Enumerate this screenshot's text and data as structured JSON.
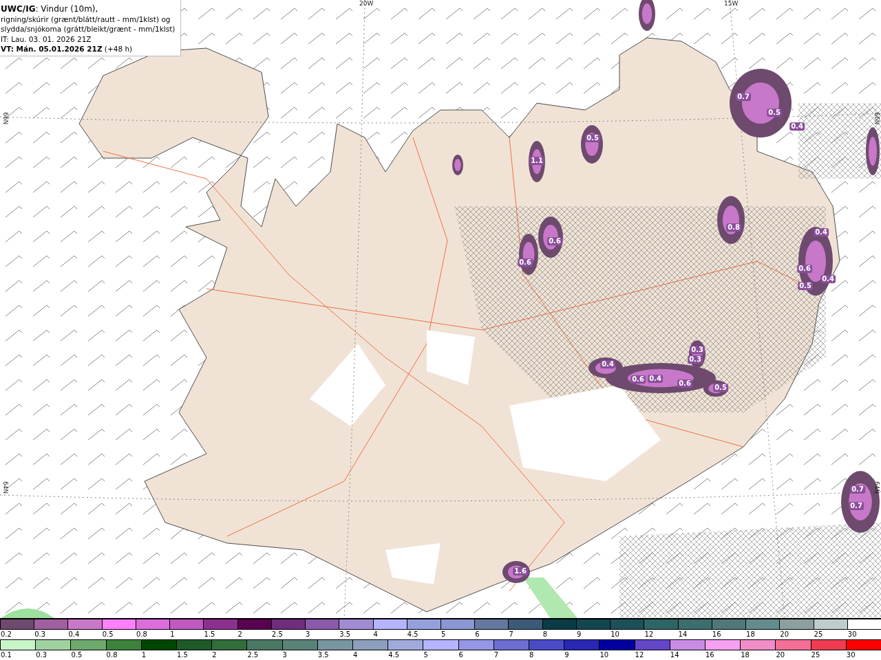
{
  "info_box": {
    "lines": [
      "**UWC/IG**: Vindur (10m),",
      "rigning/skúrir (grænt/blátt/rautt - mm/1klst) og",
      "slydda/snjókoma (grátt/bleikt/grænt - mm/1klst)",
      "IT: Lau. 03. 01. 2026 21Z",
      "**VT: Mán. 05.01.2026 21Z** (+48 h)"
    ]
  },
  "axis_labels": {
    "top": [
      "20W",
      "15W"
    ],
    "left": [
      "66N",
      "64N"
    ],
    "right": [
      "66N",
      "64N"
    ]
  },
  "map_labels": [
    "0.7",
    "0.5",
    "0.4",
    "0.5",
    "1.1",
    "0.8",
    "0.6",
    "0.6",
    "0.4",
    "0.6",
    "0.5",
    "0.4",
    "0.3",
    "0.3",
    "0.4",
    "0.6",
    "0.4",
    "0.6",
    "0.5",
    "0.7",
    "0.7",
    "1.6"
  ],
  "legends": [
    {
      "items": [
        {
          "label": "0.2",
          "color": "#6e4a6e"
        },
        {
          "label": "0.3",
          "color": "#a0609f"
        },
        {
          "label": "0.4",
          "color": "#c878c8"
        },
        {
          "label": "0.5",
          "color": "#ff80ff"
        },
        {
          "label": "0.8",
          "color": "#dc6edc"
        },
        {
          "label": "1",
          "color": "#c05ac0"
        },
        {
          "label": "1.5",
          "color": "#8c3090"
        },
        {
          "label": "2",
          "color": "#5a0050"
        },
        {
          "label": "2.5",
          "color": "#6e2d7d"
        },
        {
          "label": "3",
          "color": "#8c5aaa"
        },
        {
          "label": "3.5",
          "color": "#a08cd2"
        },
        {
          "label": "4",
          "color": "#b4b4ff"
        },
        {
          "label": "4.5",
          "color": "#96a0dc"
        },
        {
          "label": "5",
          "color": "#8c96d2"
        },
        {
          "label": "6",
          "color": "#6478a0"
        },
        {
          "label": "7",
          "color": "#3c5a78"
        },
        {
          "label": "8",
          "color": "#0a3c46"
        },
        {
          "label": "9",
          "color": "#144650"
        },
        {
          "label": "10",
          "color": "#1e505a"
        },
        {
          "label": "12",
          "color": "#2d6464"
        },
        {
          "label": "14",
          "color": "#3c6e6e"
        },
        {
          "label": "16",
          "color": "#507878"
        },
        {
          "label": "18",
          "color": "#648c8c"
        },
        {
          "label": "20",
          "color": "#8ca0a0"
        },
        {
          "label": "25",
          "color": "#c0cccc"
        },
        {
          "label": "30",
          "color": "#ffffff"
        }
      ]
    },
    {
      "items": [
        {
          "label": "0.1",
          "color": "#c8f5c8"
        },
        {
          "label": "0.3",
          "color": "#a0d2a0"
        },
        {
          "label": "0.5",
          "color": "#6eaa6e"
        },
        {
          "label": "0.8",
          "color": "#3c823c"
        },
        {
          "label": "1",
          "color": "#004600"
        },
        {
          "label": "1.5",
          "color": "#1e5a28"
        },
        {
          "label": "2",
          "color": "#326e3c"
        },
        {
          "label": "2.5",
          "color": "#4b7864"
        },
        {
          "label": "3",
          "color": "#5a8278"
        },
        {
          "label": "3.5",
          "color": "#7896a0"
        },
        {
          "label": "4",
          "color": "#8ca0be"
        },
        {
          "label": "4.5",
          "color": "#a0aadc"
        },
        {
          "label": "5",
          "color": "#b4b4ff"
        },
        {
          "label": "6",
          "color": "#9696e6"
        },
        {
          "label": "7",
          "color": "#6e6ed2"
        },
        {
          "label": "8",
          "color": "#4b4bc8"
        },
        {
          "label": "9",
          "color": "#2828b4"
        },
        {
          "label": "10",
          "color": "#0000a0"
        },
        {
          "label": "12",
          "color": "#6446c8"
        },
        {
          "label": "14",
          "color": "#c88ce6"
        },
        {
          "label": "16",
          "color": "#f5a0f0"
        },
        {
          "label": "18",
          "color": "#f08cc8"
        },
        {
          "label": "20",
          "color": "#f56e96"
        },
        {
          "label": "25",
          "color": "#f03c50"
        },
        {
          "label": "30",
          "color": "#ff0000"
        }
      ]
    }
  ]
}
